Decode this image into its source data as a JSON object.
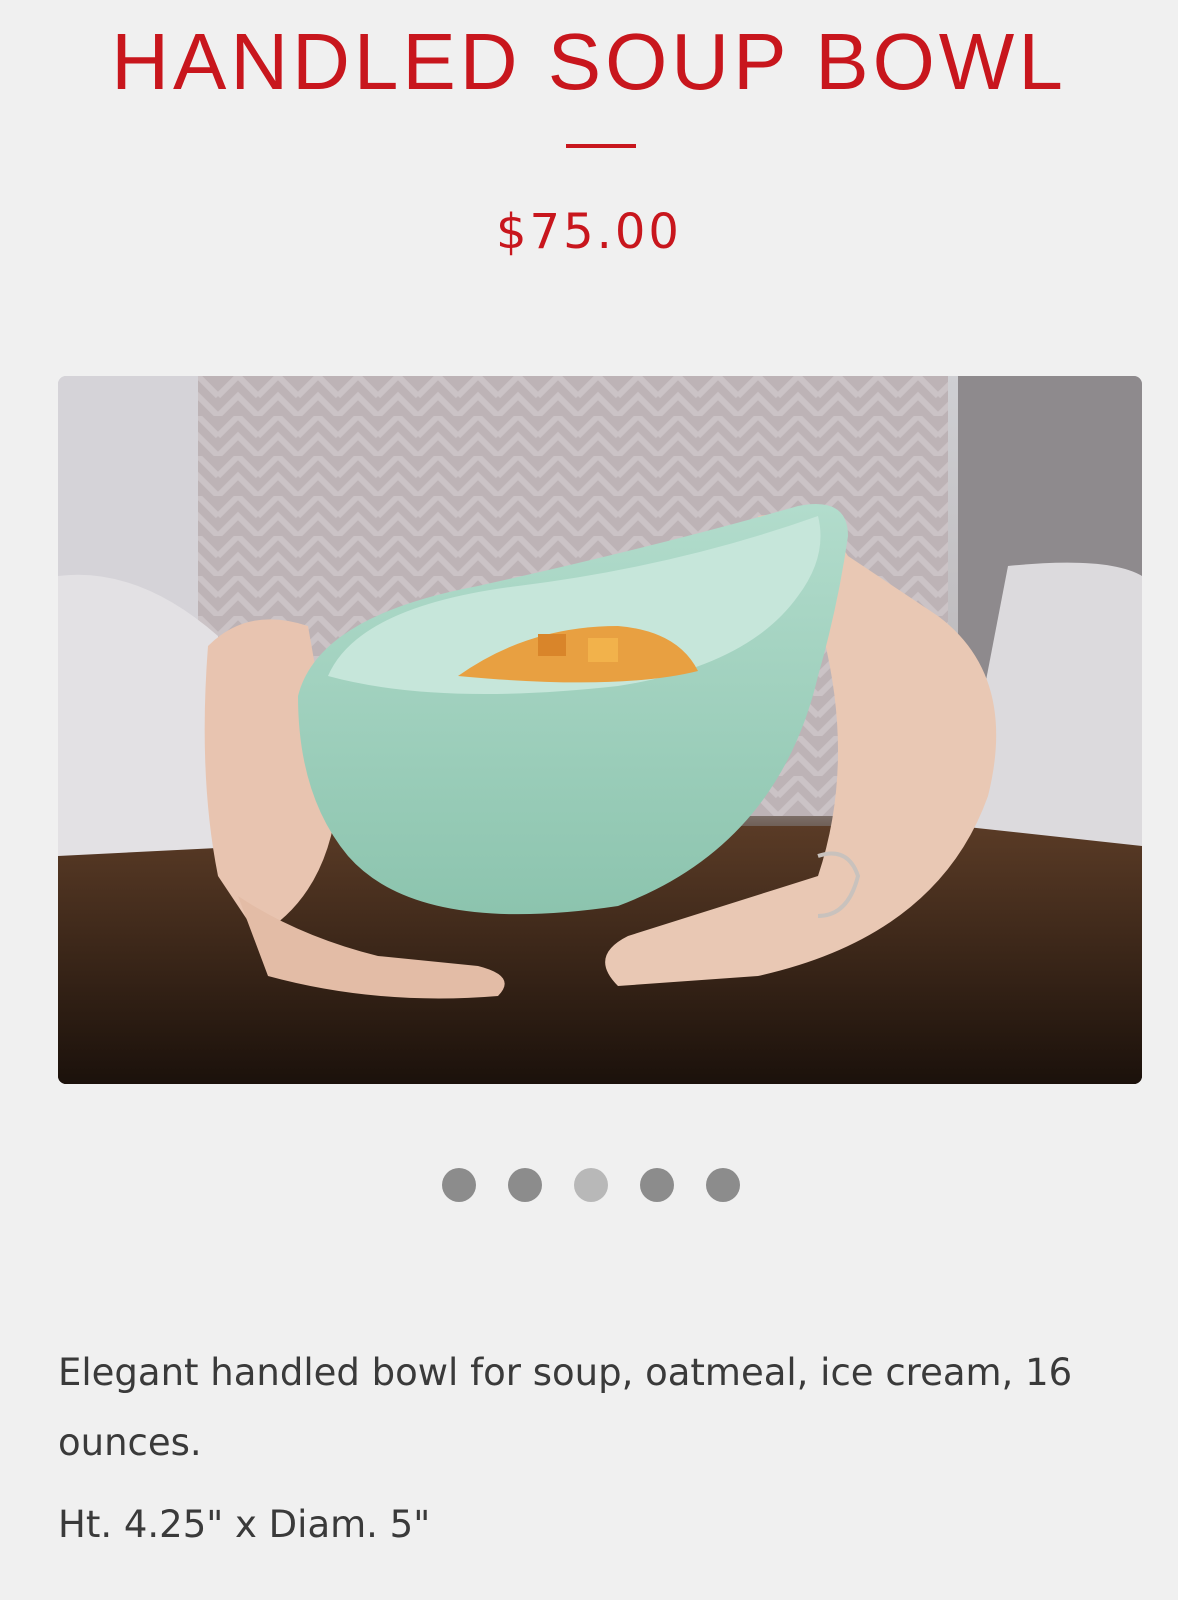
{
  "product": {
    "title": "HANDLED SOUP BOWL",
    "price": "$75.00",
    "description": "Elegant handled bowl for soup, oatmeal, ice cream, 16 ounces.",
    "dimensions": "Ht. 4.25\" x Diam. 5\""
  },
  "gallery": {
    "slide_count": 5,
    "active_index": 3,
    "image_subject": "hands-holding-mint-handled-bowl"
  },
  "colors": {
    "accent": "#c8161d",
    "body_text": "#3a3a3a",
    "background": "#f0f0f0",
    "dot": "#8c8c8c",
    "dot_active": "#b8b8b8",
    "bowl": "#9fd1be"
  }
}
